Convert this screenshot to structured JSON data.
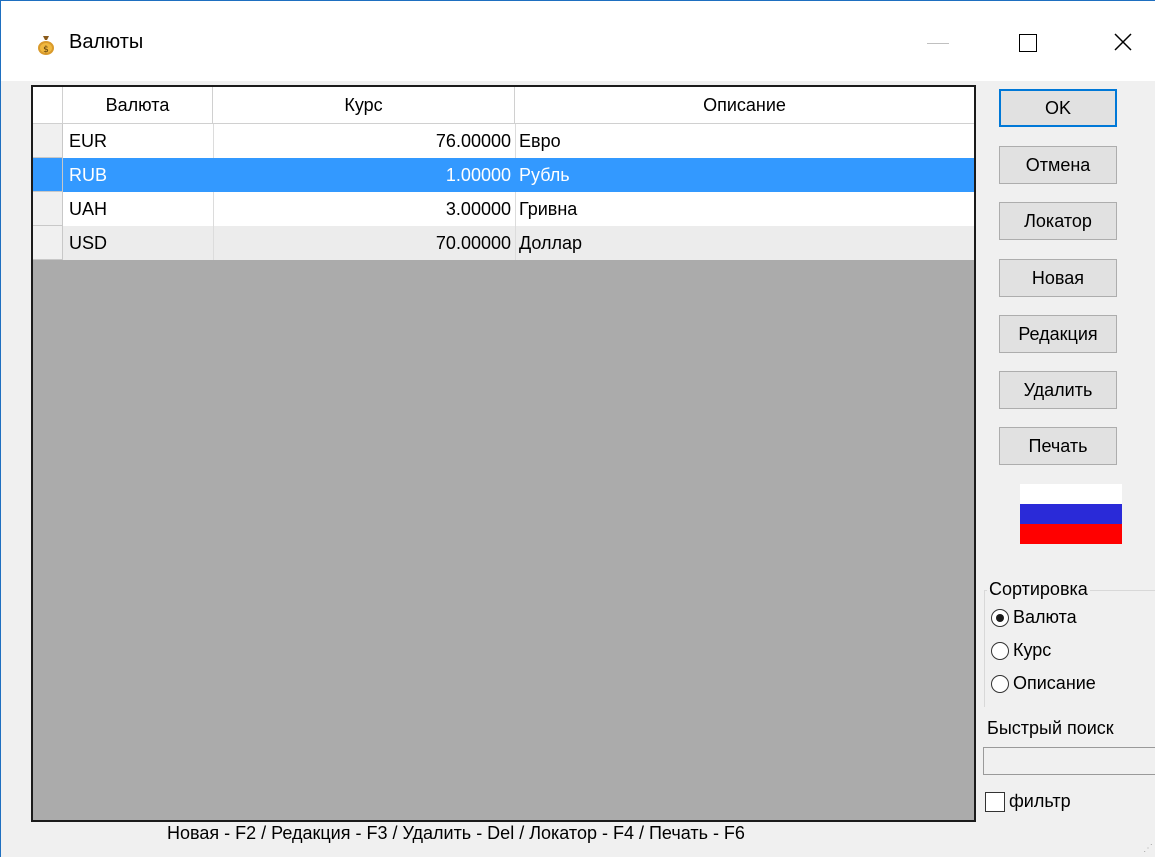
{
  "window": {
    "title": "Валюты",
    "icon": "money-bag-icon",
    "controls": {
      "minimize": "—",
      "maximize": "☐",
      "close": "✕"
    }
  },
  "grid": {
    "columns": [
      "Валюта",
      "Курс",
      "Описание"
    ],
    "rows": [
      {
        "currency": "EUR",
        "rate": "76.00000",
        "description": "Евро",
        "selected": false
      },
      {
        "currency": "RUB",
        "rate": "1.00000",
        "description": "Рубль",
        "selected": true
      },
      {
        "currency": "UAH",
        "rate": "3.00000",
        "description": "Гривна",
        "selected": false
      },
      {
        "currency": "USD",
        "rate": "70.00000",
        "description": "Доллар",
        "selected": false
      }
    ],
    "empty_area_color": "#ababab",
    "selection_color": "#3399ff"
  },
  "buttons": {
    "ok": "OK",
    "cancel": "Отмена",
    "locator": "Локатор",
    "new": "Новая",
    "edit": "Редакция",
    "delete": "Удалить",
    "print": "Печать"
  },
  "flag": {
    "name": "russia-flag-icon",
    "colors": [
      "#ffffff",
      "#2a2ad8",
      "#ff0000"
    ]
  },
  "sort": {
    "title": "Сортировка",
    "options": [
      "Валюта",
      "Курс",
      "Описание"
    ],
    "selected": "Валюта"
  },
  "search": {
    "label": "Быстрый поиск",
    "value": ""
  },
  "filter": {
    "label": "фильтр",
    "checked": false
  },
  "status_bar": "Новая - F2 / Редакция - F3 / Удалить - Del / Локатор - F4 / Печать - F6"
}
